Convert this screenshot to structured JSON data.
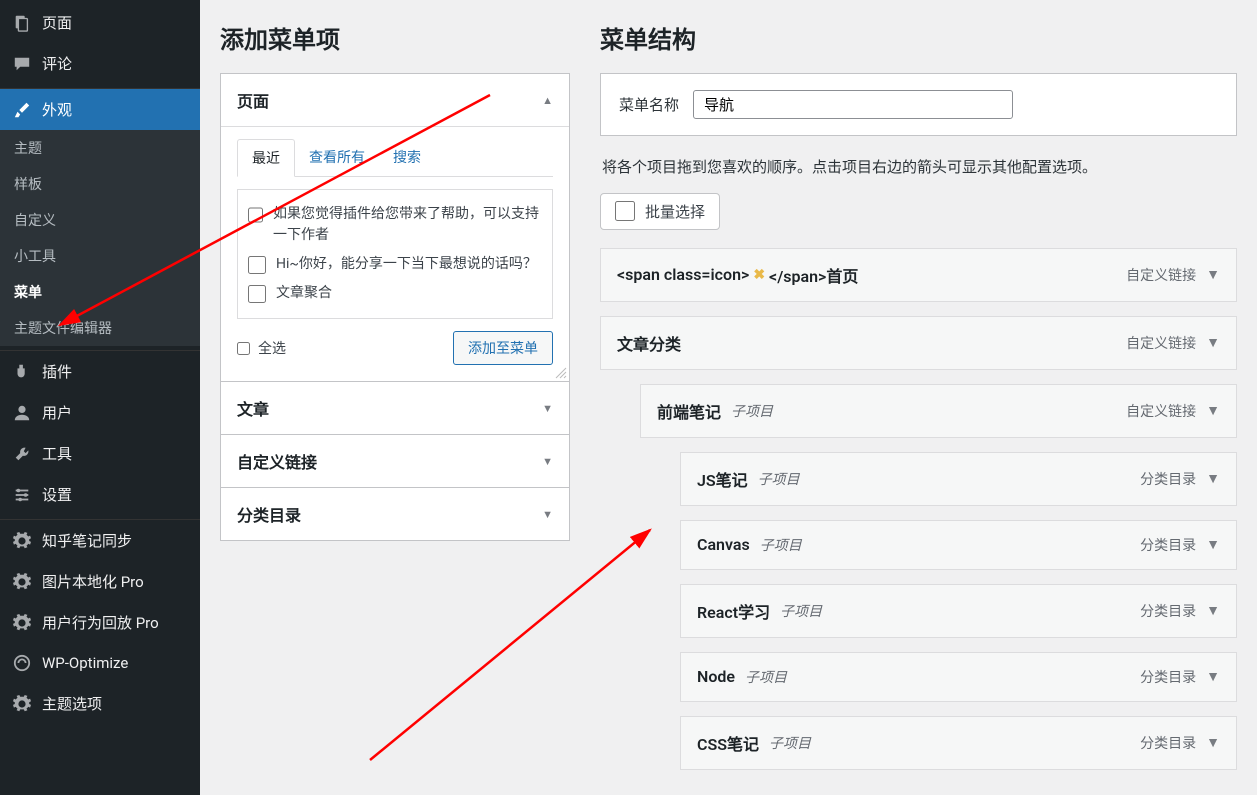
{
  "sidebar": {
    "top": [
      {
        "label": "页面",
        "icon": "pages"
      },
      {
        "label": "评论",
        "icon": "comments"
      }
    ],
    "appearance": {
      "label": "外观",
      "icon": "brush"
    },
    "appearance_sub": [
      {
        "label": "主题"
      },
      {
        "label": "样板"
      },
      {
        "label": "自定义"
      },
      {
        "label": "小工具"
      },
      {
        "label": "菜单",
        "current": true
      },
      {
        "label": "主题文件编辑器"
      }
    ],
    "bottom": [
      {
        "label": "插件",
        "icon": "plugins"
      },
      {
        "label": "用户",
        "icon": "users"
      },
      {
        "label": "工具",
        "icon": "tools"
      },
      {
        "label": "设置",
        "icon": "settings"
      }
    ],
    "extra": [
      {
        "label": "知乎笔记同步",
        "icon": "gear"
      },
      {
        "label": "图片本地化 Pro",
        "icon": "gear"
      },
      {
        "label": "用户行为回放 Pro",
        "icon": "gear"
      },
      {
        "label": "WP-Optimize",
        "icon": "optimize"
      },
      {
        "label": "主题选项",
        "icon": "gear"
      }
    ]
  },
  "left": {
    "title": "添加菜单项",
    "accordion": {
      "pages_label": "页面",
      "tabs": {
        "recent": "最近",
        "view_all": "查看所有",
        "search": "搜索"
      },
      "items": [
        "如果您觉得插件给您带来了帮助，可以支持一下作者",
        "Hi~你好，能分享一下当下最想说的话吗？",
        "文章聚合"
      ],
      "select_all": "全选",
      "add_btn": "添加至菜单",
      "posts_label": "文章",
      "custom_links_label": "自定义链接",
      "categories_label": "分类目录"
    }
  },
  "right": {
    "title": "菜单结构",
    "menu_name_label": "菜单名称",
    "menu_name_value": "导航",
    "instructions": "将各个项目拖到您喜欢的顺序。点击项目右边的箭头可显示其他配置选项。",
    "bulk_select": "批量选择",
    "type_custom": "自定义链接",
    "type_category": "分类目录",
    "sub_label": "子项目",
    "items": [
      {
        "label_html": "<span class=icon> ✕ </span>首页",
        "type": "custom",
        "depth": 0,
        "star": true
      },
      {
        "label": "文章分类",
        "type": "custom",
        "depth": 0
      },
      {
        "label": "前端笔记",
        "type": "custom",
        "depth": 1,
        "sub": true
      },
      {
        "label": "JS笔记",
        "type": "category",
        "depth": 2,
        "sub": true
      },
      {
        "label": "Canvas",
        "type": "category",
        "depth": 2,
        "sub": true
      },
      {
        "label": "React学习",
        "type": "category",
        "depth": 2,
        "sub": true
      },
      {
        "label": "Node",
        "type": "category",
        "depth": 2,
        "sub": true
      },
      {
        "label": "CSS笔记",
        "type": "category",
        "depth": 2,
        "sub": true
      }
    ]
  }
}
